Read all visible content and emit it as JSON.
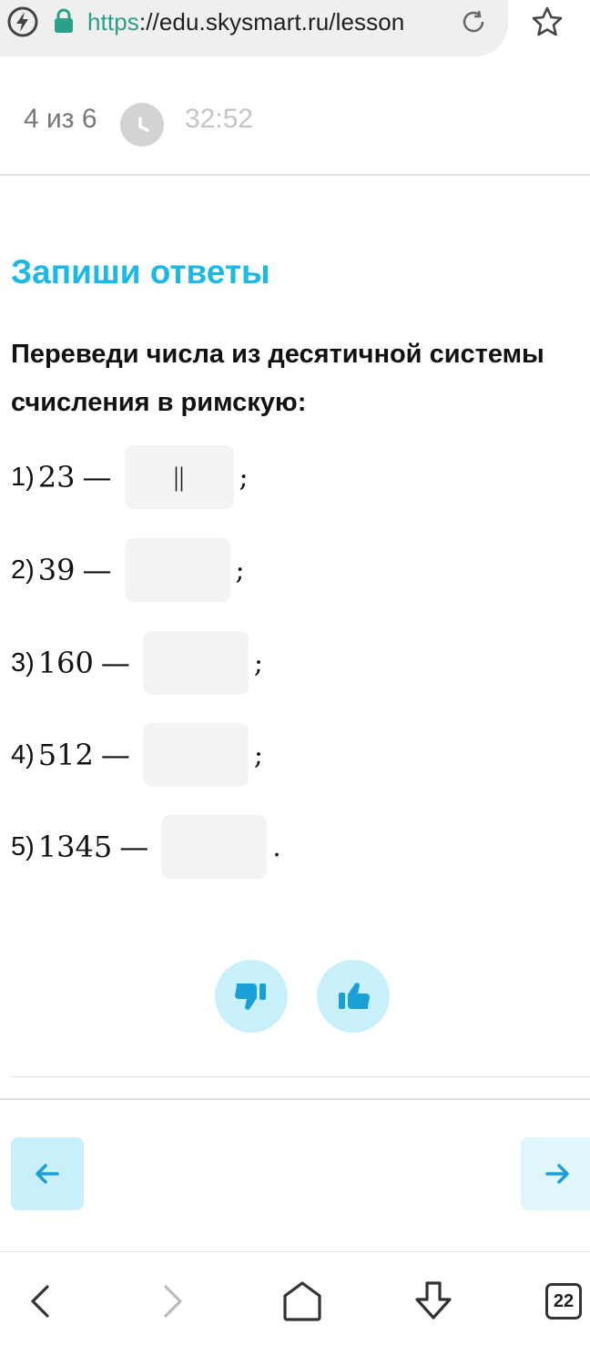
{
  "browser": {
    "url_scheme": "https",
    "url_rest": "://edu.skysmart.ru/lesson",
    "tab_count": "22"
  },
  "header": {
    "progress": "4 из 6",
    "timer": "32:52"
  },
  "task": {
    "title": "Запиши ответы",
    "instruction": "Переведи числа из десятичной системы счисления в римскую:",
    "items": [
      {
        "label": "1)",
        "number": "23",
        "dash": "—",
        "value": "||",
        "punct": ";"
      },
      {
        "label": "2)",
        "number": "39",
        "dash": "—",
        "value": "",
        "punct": ";"
      },
      {
        "label": "3)",
        "number": "160",
        "dash": "—",
        "value": "",
        "punct": ";"
      },
      {
        "label": "4)",
        "number": "512",
        "dash": "—",
        "value": "",
        "punct": ";"
      },
      {
        "label": "5)",
        "number": "1345",
        "dash": "—",
        "value": "",
        "punct": "."
      }
    ]
  },
  "colors": {
    "accent": "#1cb8e6",
    "button_bg": "#c8f0fb",
    "icon": "#1a9fd6"
  },
  "icons": [
    "lightning-icon",
    "lock-icon",
    "reload-icon",
    "star-icon",
    "clock-icon",
    "thumbs-down-icon",
    "thumbs-up-icon",
    "arrow-left-icon",
    "arrow-right-icon",
    "back-icon",
    "forward-icon",
    "home-icon",
    "download-icon",
    "tabs-icon"
  ]
}
